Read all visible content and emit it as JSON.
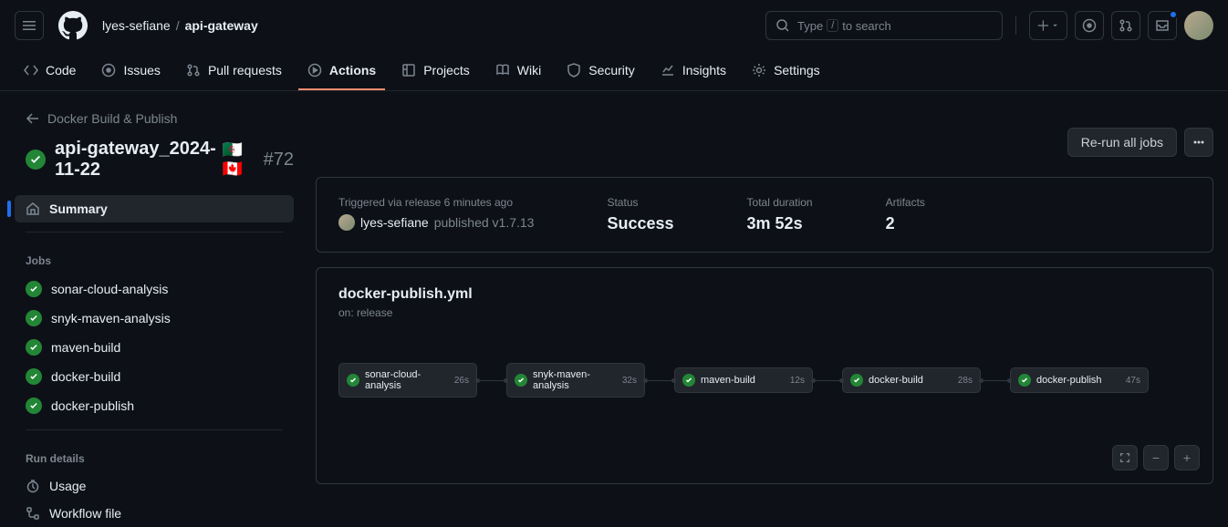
{
  "header": {
    "owner": "lyes-sefiane",
    "repo": "api-gateway",
    "search_placeholder_pre": "Type",
    "search_key": "/",
    "search_placeholder_post": "to search"
  },
  "tabs": [
    {
      "label": "Code"
    },
    {
      "label": "Issues"
    },
    {
      "label": "Pull requests"
    },
    {
      "label": "Actions"
    },
    {
      "label": "Projects"
    },
    {
      "label": "Wiki"
    },
    {
      "label": "Security"
    },
    {
      "label": "Insights"
    },
    {
      "label": "Settings"
    }
  ],
  "back_label": "Docker Build & Publish",
  "run": {
    "title": "api-gateway_2024-11-22",
    "flags": "🇩🇿🇨🇦",
    "number": "#72"
  },
  "actions": {
    "rerun": "Re-run all jobs"
  },
  "sidebar": {
    "summary": "Summary",
    "jobs_header": "Jobs",
    "jobs": [
      "sonar-cloud-analysis",
      "snyk-maven-analysis",
      "maven-build",
      "docker-build",
      "docker-publish"
    ],
    "run_details_header": "Run details",
    "usage": "Usage",
    "workflow_file": "Workflow file"
  },
  "summary": {
    "triggered": "Triggered via release 6 minutes ago",
    "publisher_user": "lyes-sefiane",
    "publisher_text": "published v1.7.13",
    "status_label": "Status",
    "status_value": "Success",
    "duration_label": "Total duration",
    "duration_value": "3m 52s",
    "artifacts_label": "Artifacts",
    "artifacts_value": "2"
  },
  "workflow": {
    "file": "docker-publish.yml",
    "on": "on: release",
    "nodes": [
      {
        "name": "sonar-cloud-analysis",
        "dur": "26s"
      },
      {
        "name": "snyk-maven-analysis",
        "dur": "32s"
      },
      {
        "name": "maven-build",
        "dur": "12s"
      },
      {
        "name": "docker-build",
        "dur": "28s"
      },
      {
        "name": "docker-publish",
        "dur": "47s"
      }
    ]
  }
}
